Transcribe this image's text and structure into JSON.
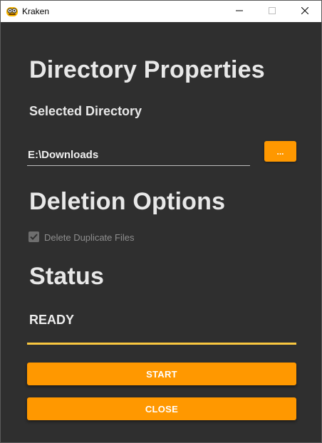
{
  "window": {
    "title": "Kraken",
    "icon": "kraken-app-icon",
    "controls": [
      "minimize-icon",
      "maximize-icon",
      "close-icon"
    ]
  },
  "directory": {
    "heading": "Directory Properties",
    "subheading": "Selected Directory",
    "path": "E:\\Downloads",
    "browse_label": "..."
  },
  "deletion": {
    "heading": "Deletion Options",
    "option_label": "Delete Duplicate Files",
    "option_checked": true,
    "option_enabled": false
  },
  "status": {
    "heading": "Status",
    "value": "READY"
  },
  "actions": {
    "start_label": "START",
    "close_label": "CLOSE"
  },
  "colors": {
    "background": "#2f2f2f",
    "accent": "#ff9800",
    "status_underline": "#f9c740",
    "titlebar": "#ffffff"
  }
}
